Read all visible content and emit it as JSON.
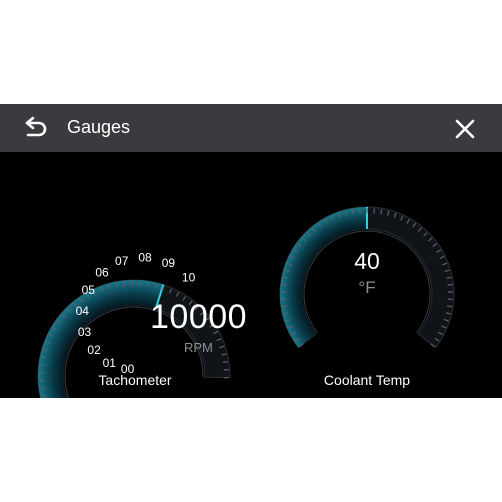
{
  "header": {
    "title": "Gauges",
    "back_icon": "back-arrow-icon",
    "close_icon": "close-icon"
  },
  "tachometer": {
    "label": "Tachometer",
    "value": "10000",
    "unit": "RPM",
    "scale": [
      "00",
      "01",
      "02",
      "03",
      "04",
      "05",
      "06",
      "07",
      "08",
      "09",
      "10"
    ],
    "fill_fraction": 0.27
  },
  "coolant": {
    "label": "Coolant Temp",
    "value": "40",
    "unit": "°F",
    "fill_fraction": 0.5
  },
  "colors": {
    "header_bg": "#3a3b3e",
    "screen_bg": "#000000",
    "accent": "#1fb3c2",
    "text": "#ffffff",
    "muted": "#8a8f96"
  }
}
